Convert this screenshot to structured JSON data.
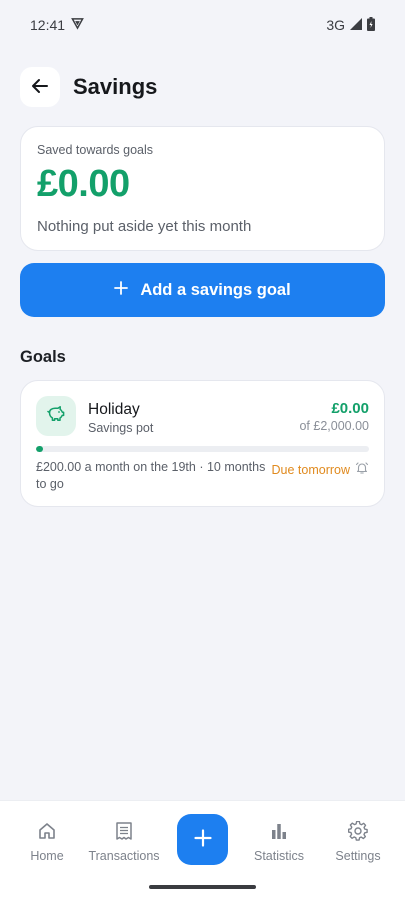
{
  "status_bar": {
    "time": "12:41",
    "network": "3G",
    "icons": [
      "shield-icon",
      "signal-icon",
      "battery-icon"
    ]
  },
  "header": {
    "title": "Savings",
    "back_icon": "arrow-left-icon"
  },
  "summary": {
    "label": "Saved towards goals",
    "amount": "£0.00",
    "subtitle": "Nothing put aside yet this month"
  },
  "add_goal": {
    "label": "Add a savings goal",
    "icon": "plus-icon"
  },
  "goals_section": {
    "title": "Goals",
    "items": [
      {
        "name": "Holiday",
        "type": "Savings pot",
        "icon": "piggy-bank-icon",
        "saved": "£0.00",
        "target": "of £2,000.00",
        "progress_fraction": 0.01,
        "schedule": "£200.00 a month on the 19th · 10 months to go",
        "due": "Due tomorrow",
        "due_icon": "alarm-icon"
      }
    ]
  },
  "bottom_nav": {
    "items": [
      {
        "label": "Home",
        "icon": "home-icon"
      },
      {
        "label": "Transactions",
        "icon": "receipt-icon"
      },
      {
        "label": "Statistics",
        "icon": "bar-chart-icon"
      },
      {
        "label": "Settings",
        "icon": "gear-icon"
      }
    ],
    "fab_icon": "plus-icon"
  },
  "colors": {
    "background": "#f3f4f9",
    "accent": "#1d7ff0",
    "positive": "#13a06a",
    "warning": "#e08a1e"
  }
}
